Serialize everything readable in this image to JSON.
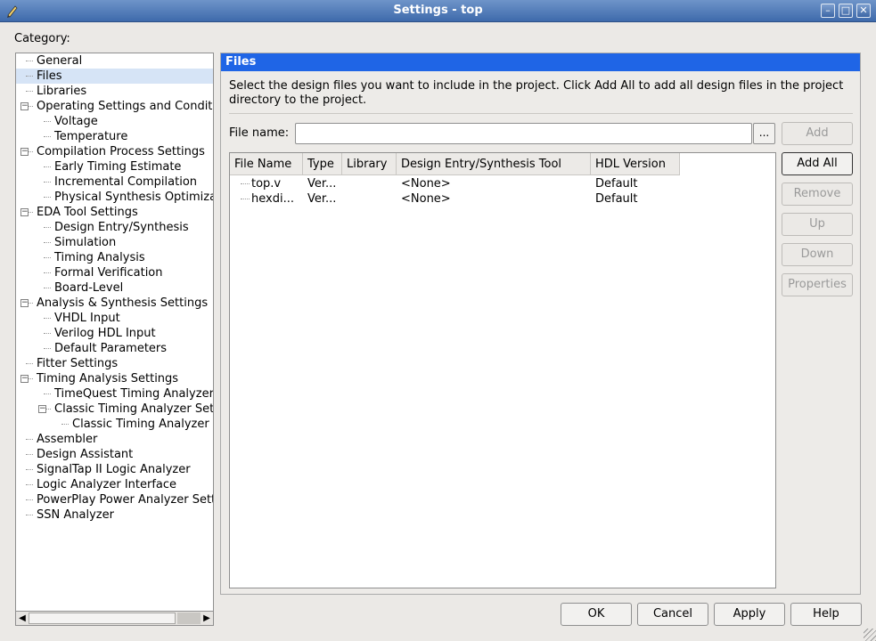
{
  "window": {
    "title": "Settings - top",
    "icon": "pencil-icon",
    "buttons": [
      "minimize-icon",
      "maximize-icon",
      "close-icon"
    ]
  },
  "category_label": "Category:",
  "tree": [
    {
      "label": "General",
      "level": 0
    },
    {
      "label": "Files",
      "level": 0,
      "selected": true
    },
    {
      "label": "Libraries",
      "level": 0
    },
    {
      "label": "Operating Settings and Conditic",
      "level": 0,
      "expander": "−"
    },
    {
      "label": "Voltage",
      "level": 1
    },
    {
      "label": "Temperature",
      "level": 1
    },
    {
      "label": "Compilation Process Settings",
      "level": 0,
      "expander": "−"
    },
    {
      "label": "Early Timing Estimate",
      "level": 1
    },
    {
      "label": "Incremental Compilation",
      "level": 1
    },
    {
      "label": "Physical Synthesis Optimiza",
      "level": 1
    },
    {
      "label": "EDA Tool Settings",
      "level": 0,
      "expander": "−"
    },
    {
      "label": "Design Entry/Synthesis",
      "level": 1
    },
    {
      "label": "Simulation",
      "level": 1
    },
    {
      "label": "Timing Analysis",
      "level": 1
    },
    {
      "label": "Formal Verification",
      "level": 1
    },
    {
      "label": "Board-Level",
      "level": 1
    },
    {
      "label": "Analysis & Synthesis Settings",
      "level": 0,
      "expander": "−"
    },
    {
      "label": "VHDL Input",
      "level": 1
    },
    {
      "label": "Verilog HDL Input",
      "level": 1
    },
    {
      "label": "Default Parameters",
      "level": 1
    },
    {
      "label": "Fitter Settings",
      "level": 0
    },
    {
      "label": "Timing Analysis Settings",
      "level": 0,
      "expander": "−"
    },
    {
      "label": "TimeQuest Timing Analyzer",
      "level": 1
    },
    {
      "label": "Classic Timing Analyzer Set",
      "level": 1,
      "expander": "−"
    },
    {
      "label": "Classic Timing Analyzer",
      "level": 2
    },
    {
      "label": "Assembler",
      "level": 0
    },
    {
      "label": "Design Assistant",
      "level": 0
    },
    {
      "label": "SignalTap II Logic Analyzer",
      "level": 0
    },
    {
      "label": "Logic Analyzer Interface",
      "level": 0
    },
    {
      "label": "PowerPlay Power Analyzer Sett",
      "level": 0
    },
    {
      "label": "SSN Analyzer",
      "level": 0
    }
  ],
  "panel": {
    "title": "Files",
    "description": "Select the design files you want to include in the project. Click Add All to add all design files in the project directory to the project.",
    "file_name_label": "File name:",
    "file_name_value": "",
    "browse_label": "...",
    "columns": [
      "File Name",
      "Type",
      "Library",
      "Design Entry/Synthesis Tool",
      "HDL Version"
    ],
    "rows": [
      [
        "top.v",
        "Ver...",
        "",
        "<None>",
        "Default"
      ],
      [
        "hexdi...",
        "Ver...",
        "",
        "<None>",
        "Default"
      ]
    ]
  },
  "side_buttons": {
    "add": "Add",
    "add_all": "Add All",
    "remove": "Remove",
    "up": "Up",
    "down": "Down",
    "properties": "Properties"
  },
  "bottom_buttons": {
    "ok": "OK",
    "cancel": "Cancel",
    "apply": "Apply",
    "help": "Help"
  }
}
